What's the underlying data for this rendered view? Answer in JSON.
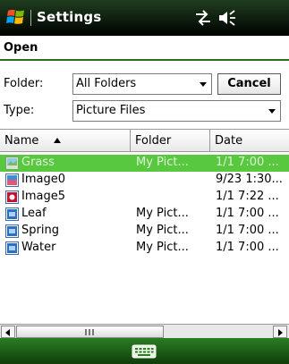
{
  "titlebar": {
    "title": "Settings",
    "icons": [
      "windows-start-icon",
      "connectivity-icon",
      "volume-icon"
    ]
  },
  "dialog": {
    "title": "Open",
    "folder_label": "Folder:",
    "folder_value": "All Folders",
    "type_label": "Type:",
    "type_value": "Picture Files",
    "cancel_label": "Cancel"
  },
  "list": {
    "columns": [
      "Name",
      "Folder",
      "Date"
    ],
    "sort_column": "Name",
    "sort_direction": "ascending",
    "rows": [
      {
        "name": "Grass",
        "folder": "My Pict...",
        "date": "1/1 7:00 ...",
        "icon": "image-file-icon",
        "selected": true
      },
      {
        "name": "Image0",
        "folder": "",
        "date": "9/23 1:30...",
        "icon": "image-file-icon",
        "selected": false
      },
      {
        "name": "Image5",
        "folder": "",
        "date": "1/1 7:22 ...",
        "icon": "image-file-red-icon",
        "selected": false
      },
      {
        "name": "Leaf",
        "folder": "My Pict...",
        "date": "1/1 7:00 ...",
        "icon": "image-file-icon",
        "selected": false
      },
      {
        "name": "Spring",
        "folder": "My Pict...",
        "date": "1/1 7:00 ...",
        "icon": "image-file-icon",
        "selected": false
      },
      {
        "name": "Water",
        "folder": "My Pict...",
        "date": "1/1 7:00 ...",
        "icon": "image-file-icon",
        "selected": false
      }
    ]
  },
  "colors": {
    "selection": "#58c83f",
    "titlebar": "#0d1a0d",
    "menubar": "#1e5d16"
  },
  "menubar": {
    "icons": [
      "keyboard-icon"
    ]
  }
}
